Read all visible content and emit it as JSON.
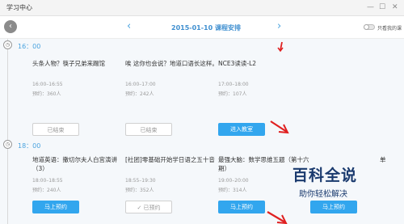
{
  "window": {
    "title": "学习中心",
    "controls": {
      "minimize": "—",
      "maximize": "☐",
      "close": "✕"
    }
  },
  "datebar": {
    "date_title": "2015-01-10 课程安排",
    "toggle_label": "只看我的课"
  },
  "sections": [
    {
      "time": "16：00",
      "cards": [
        {
          "title": "头条人物？筷子兄弟来踢馆",
          "time": "16:00–16:55",
          "booked": "预约：360人",
          "button": "已结束"
        },
        {
          "title": "唉 这你也会说？地道口语长这样。",
          "time": "16:00–17:00",
          "booked": "预约：242人",
          "button": "已结束"
        },
        {
          "title": "NCE3读读-L2",
          "time": "17:00–18:00",
          "booked": "预约：107人",
          "button": "进入教室"
        }
      ]
    },
    {
      "time": "18：00",
      "cards": [
        {
          "title": "地道英语：撒切尔夫人白宫演讲（3）",
          "time": "18:00–18:55",
          "booked": "预约：240人",
          "button": "马上预约"
        },
        {
          "title": "[社团]零基础开始学日语之五十音",
          "time": "18:55–19:30",
          "booked": "预约：352人",
          "button": "已预约"
        },
        {
          "title": "最强大脑：数学思维五题（第十六期）",
          "time": "19:00–20:00",
          "booked": "预约：314人",
          "button": "马上预约"
        },
        {
          "title": "单",
          "time": "",
          "booked": "",
          "button": "马上预约"
        }
      ]
    }
  ],
  "watermark": {
    "main": "百科全说",
    "sub": "助你轻松解决"
  },
  "colors": {
    "accent": "#32a6ee",
    "annotation": "#e02020",
    "watermark": "#1a3a6e"
  }
}
